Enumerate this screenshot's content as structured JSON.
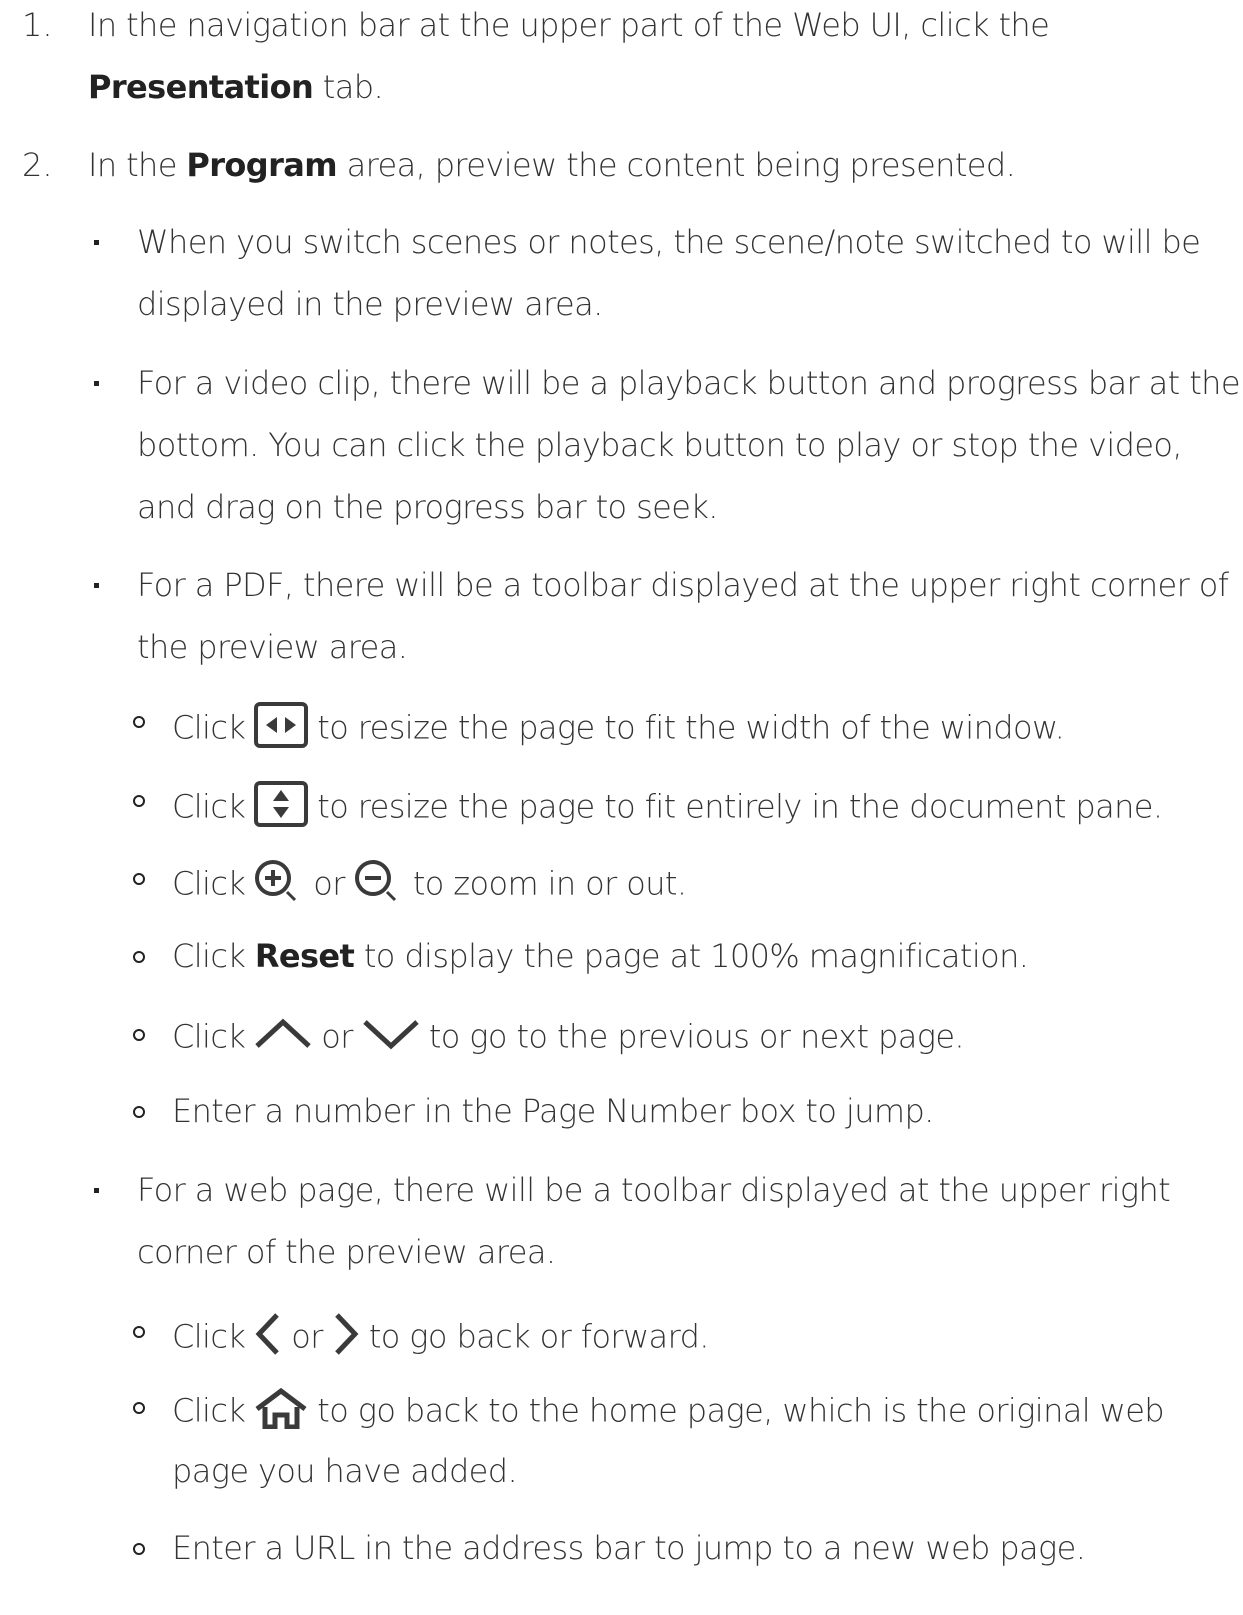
{
  "steps": [
    {
      "number": "1.",
      "lines": [
        {
          "text": "In the navigation bar at the upper part of the Web UI, click the"
        },
        {
          "bold": "Presentation",
          "after": " tab."
        }
      ]
    },
    {
      "number": "2.",
      "intro": {
        "before": "In the ",
        "bold": "Program",
        "after": " area, preview the content being presented."
      },
      "bullets": [
        {
          "lines": [
            "When you switch scenes or notes, the scene/note switched to will be",
            "displayed in the preview area."
          ]
        },
        {
          "lines": [
            "For a video clip, there will be a playback button and progress bar at the",
            "bottom. You can click the playback button to play or stop the video,",
            "and drag on the progress bar to seek."
          ]
        },
        {
          "lines": [
            "For a PDF, there will be a toolbar displayed at the upper right corner of",
            "the preview area."
          ],
          "sub": [
            {
              "click": "Click",
              "after": "to resize the page to fit the width of the window.",
              "icons": [
                "fit-width-icon"
              ]
            },
            {
              "click": "Click",
              "after": "to resize the page to fit entirely in the document pane.",
              "icons": [
                "fit-page-icon"
              ]
            },
            {
              "click": "Click",
              "or": "or",
              "after": "to zoom in or out.",
              "icons": [
                "zoom-in-icon",
                "zoom-out-icon"
              ]
            },
            {
              "click": "Click",
              "bold": "Reset",
              "after": " to display the page at 100% magnification."
            },
            {
              "click": "Click",
              "or": "or",
              "after": "to go to the previous or next page.",
              "icons": [
                "chevron-up-icon",
                "chevron-down-icon"
              ]
            },
            {
              "text": "Enter a number in the Page Number box to jump."
            }
          ]
        },
        {
          "lines": [
            "For a web page, there will be a toolbar displayed at the upper right",
            "corner of the preview area."
          ],
          "sub": [
            {
              "click": "Click",
              "or": "or",
              "after": "to go back or forward.",
              "icons": [
                "chevron-left-icon",
                "chevron-right-icon"
              ]
            },
            {
              "click": "Click",
              "after": "to go back to the home page, which is the original web",
              "after2": "page you have added.",
              "icons": [
                "home-icon"
              ]
            },
            {
              "text": "Enter a URL in the address bar to jump to a new web page."
            }
          ]
        }
      ]
    }
  ]
}
